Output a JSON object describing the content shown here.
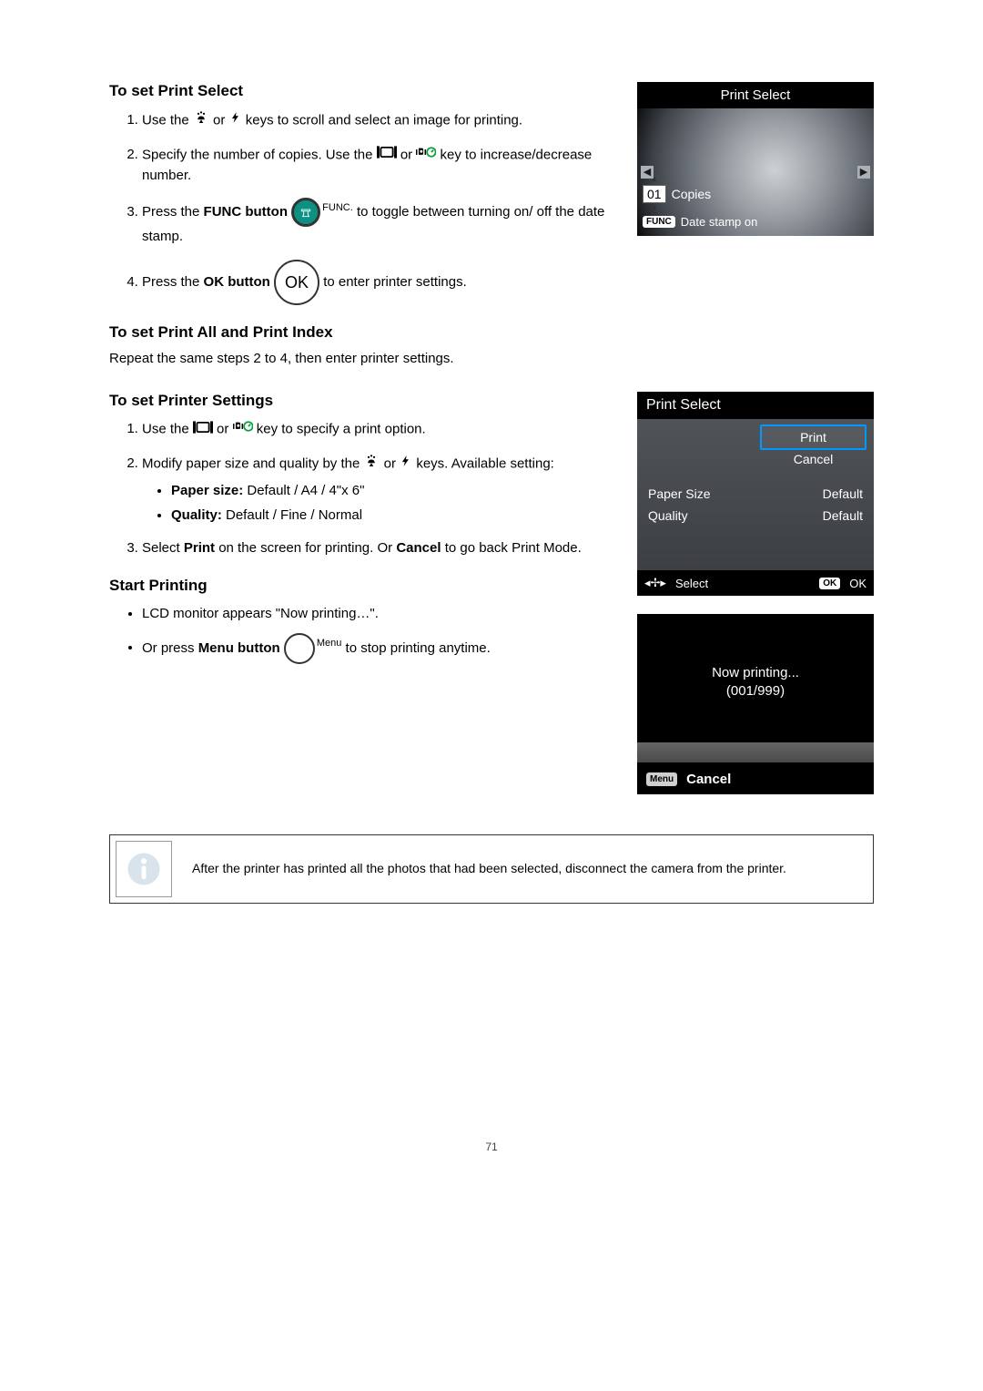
{
  "sec1": {
    "heading": "To set Print Select",
    "step1_a": "Use the ",
    "step1_b": " or ",
    "step1_c": " keys to scroll and select an image for printing.",
    "step2_a": "Specify the number of copies. Use the ",
    "step2_b": " or ",
    "step2_c": " key to increase/decrease number.",
    "step3_a": "Press the ",
    "step3_bold": "FUNC button",
    "step3_b": " ",
    "step3_func_label": "FUNC.",
    "step3_c": " to toggle between turning on/ off the date stamp.",
    "step4_a": "Press the ",
    "step4_bold": "OK button",
    "step4_ok": "OK",
    "step4_b": " to enter printer settings."
  },
  "sec2": {
    "heading": "To set Print All and Print Index",
    "text": "Repeat the same steps 2 to 4, then enter printer settings."
  },
  "sec3": {
    "heading": "To set Printer Settings",
    "step1_a": "Use the ",
    "step1_b": " or ",
    "step1_c": " key to specify a print option.",
    "step2_a": "Modify paper size and quality by the ",
    "step2_b": " or ",
    "step2_c": " keys. Available setting:",
    "sub_paper_label": "Paper size:",
    "sub_paper_val": " Default / A4 / 4\"x 6\"",
    "sub_quality_label": "Quality:",
    "sub_quality_val": " Default / Fine / Normal",
    "step3_a": "Select ",
    "step3_bold1": "Print",
    "step3_b": " on the screen for printing. Or ",
    "step3_bold2": "Cancel",
    "step3_c": " to go back Print Mode."
  },
  "sec4": {
    "heading": "Start Printing",
    "b1": "LCD monitor appears \"Now printing…\".",
    "b2_a": "Or press ",
    "b2_bold": "Menu button",
    "b2_menu_label": "Menu",
    "b2_b": " to stop printing anytime."
  },
  "note": "After the printer has printed all the photos that had been selected, disconnect the camera from the printer.",
  "lcd1": {
    "title": "Print Select",
    "copies_val": "01",
    "copies_label": "Copies",
    "func_pill": "FUNC",
    "date_text": "Date stamp on"
  },
  "lcd2": {
    "title": "Print Select",
    "print": "Print",
    "cancel": "Cancel",
    "paper_k": "Paper Size",
    "paper_v": "Default",
    "quality_k": "Quality",
    "quality_v": "Default",
    "select": "Select",
    "ok_pill": "OK",
    "ok": "OK"
  },
  "lcd3": {
    "printing": "Now printing...",
    "progress": "(001/999)",
    "menu_pill": "Menu",
    "cancel": "Cancel"
  },
  "page_num": "71"
}
